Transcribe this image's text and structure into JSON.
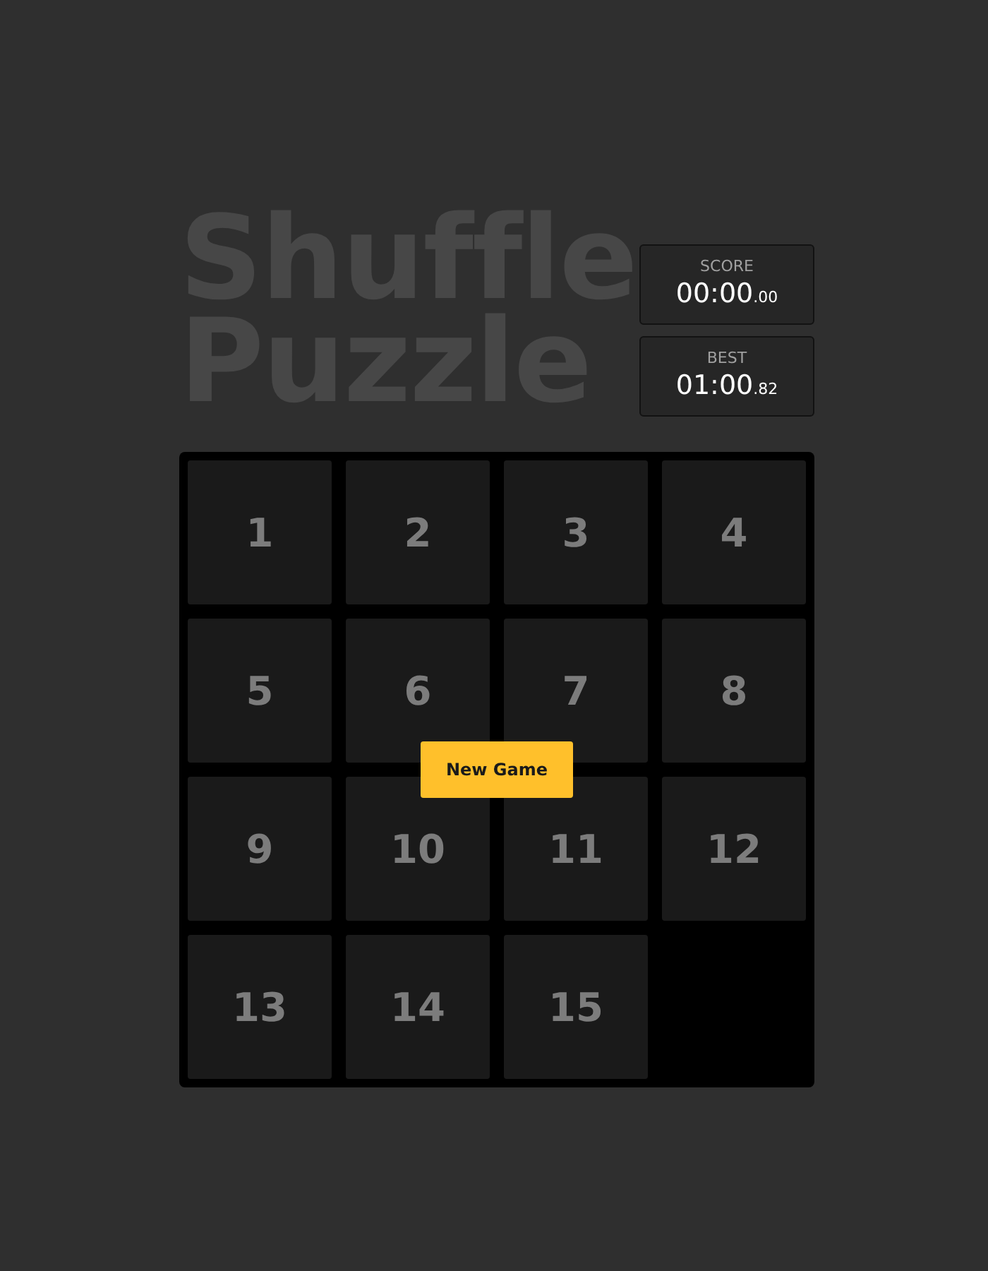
{
  "title": "Shuffle Puzzle",
  "scores": [
    {
      "label": "SCORE",
      "value": "00:00$_{.00}$"
    },
    {
      "label": "BEST",
      "value": "01:00$_{.82}$"
    }
  ],
  "tiles": [
    "1",
    "2",
    "3",
    "4",
    "5",
    "6",
    "7",
    "8",
    "9",
    "10",
    "11",
    "12",
    "13",
    "14",
    "15"
  ],
  "new_game_button": "New Game"
}
